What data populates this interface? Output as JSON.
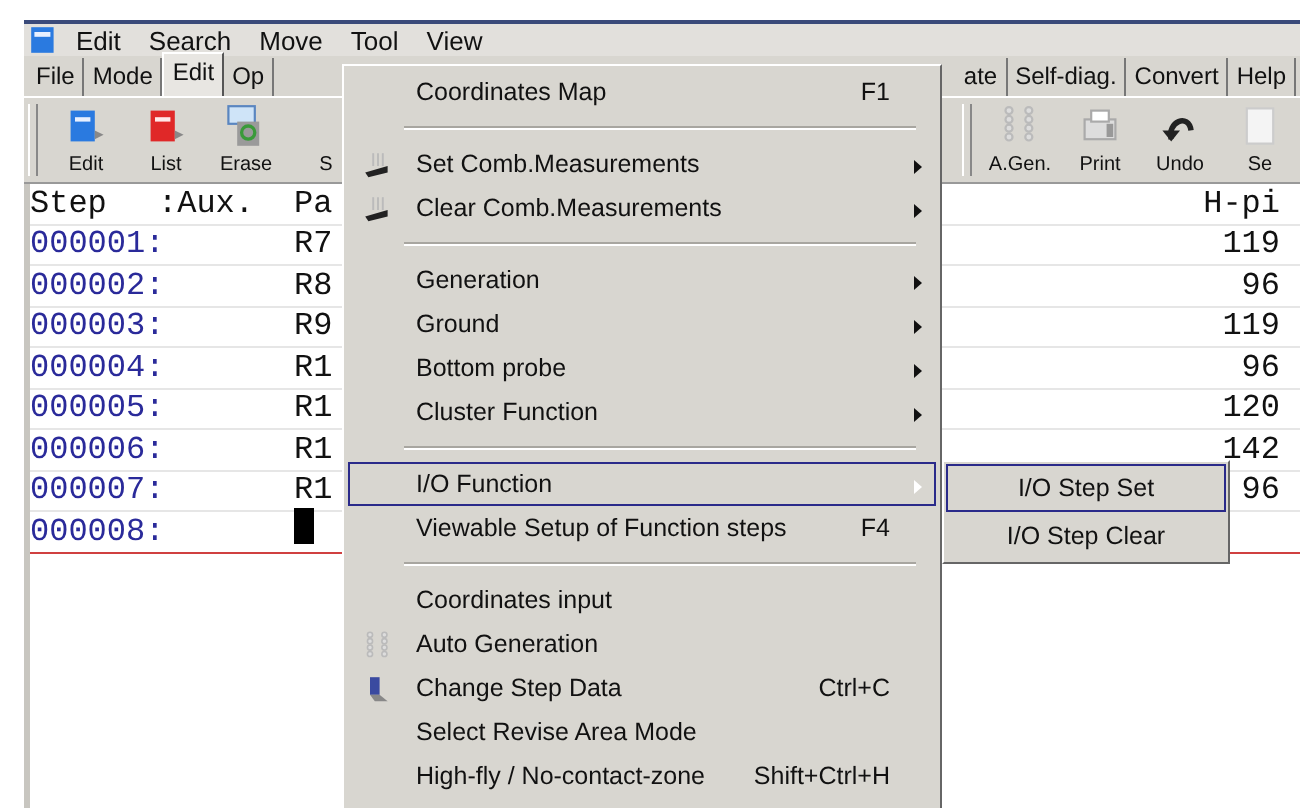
{
  "menubar": {
    "items": [
      {
        "label": "Edit"
      },
      {
        "label": "Search"
      },
      {
        "label": "Move"
      },
      {
        "label": "Tool"
      },
      {
        "label": "View"
      }
    ]
  },
  "tab_bar": {
    "left": [
      {
        "label": "File",
        "selected": false
      },
      {
        "label": "Mode",
        "selected": false
      },
      {
        "label": "Edit",
        "selected": true
      },
      {
        "label": "Op",
        "selected": false
      }
    ],
    "right": [
      {
        "label": "ate",
        "selected": false
      },
      {
        "label": "Self-diag.",
        "selected": false
      },
      {
        "label": "Convert",
        "selected": false
      },
      {
        "label": "Help",
        "selected": false
      }
    ]
  },
  "toolbar": {
    "left": [
      {
        "label": "Edit",
        "kind": "blue-book"
      },
      {
        "label": "List",
        "kind": "red-book"
      },
      {
        "label": "Erase",
        "kind": "erase"
      },
      {
        "label": "S",
        "kind": "none"
      }
    ],
    "right": [
      {
        "label": "A.Gen.",
        "kind": "pins"
      },
      {
        "label": "Print",
        "kind": "printer"
      },
      {
        "label": "Undo",
        "kind": "undo"
      },
      {
        "label": "Se",
        "kind": "page"
      }
    ]
  },
  "grid": {
    "columns": {
      "step": "Step",
      "aux": ":Aux.",
      "parameter": "Pa",
      "h_pin": "H-pi"
    },
    "rows": [
      {
        "step": "000001:",
        "parameter": "R7",
        "h_pin": "119",
        "cursor": false
      },
      {
        "step": "000002:",
        "parameter": "R8",
        "h_pin": "96",
        "cursor": false
      },
      {
        "step": "000003:",
        "parameter": "R9",
        "h_pin": "119",
        "cursor": false
      },
      {
        "step": "000004:",
        "parameter": "R1",
        "h_pin": "96",
        "cursor": false
      },
      {
        "step": "000005:",
        "parameter": "R1",
        "h_pin": "120",
        "cursor": false
      },
      {
        "step": "000006:",
        "parameter": "R1",
        "h_pin": "142",
        "cursor": false
      },
      {
        "step": "000007:",
        "parameter": "R1",
        "h_pin": "96",
        "cursor": false
      },
      {
        "step": "000008:",
        "cursor": true
      }
    ]
  },
  "tool_menu": {
    "items": [
      {
        "kind": "item",
        "label": "Coordinates Map",
        "shortcut": "F1",
        "submenu": false,
        "selected": false
      },
      {
        "kind": "separator"
      },
      {
        "kind": "comb-item",
        "label": "Set Comb.Measurements",
        "submenu": true,
        "selected": false
      },
      {
        "kind": "comb-item",
        "label": "Clear Comb.Measurements",
        "submenu": true,
        "selected": false
      },
      {
        "kind": "separator"
      },
      {
        "kind": "item",
        "label": "Generation",
        "submenu": true,
        "selected": false
      },
      {
        "kind": "item",
        "label": "Ground",
        "submenu": true,
        "selected": false
      },
      {
        "kind": "item",
        "label": "Bottom probe",
        "submenu": true,
        "selected": false
      },
      {
        "kind": "item",
        "label": "Cluster Function",
        "submenu": true,
        "selected": false
      },
      {
        "kind": "separator"
      },
      {
        "kind": "item",
        "label": "I/O Function",
        "submenu": true,
        "selected": true,
        "submenu_items": [
          {
            "label": "I/O Step Set",
            "selected": true
          },
          {
            "label": "I/O Step Clear",
            "selected": false
          }
        ]
      },
      {
        "kind": "item",
        "label": "Viewable Setup of Function steps",
        "shortcut": "F4",
        "submenu": false,
        "selected": false
      },
      {
        "kind": "separator"
      },
      {
        "kind": "item",
        "label": "Coordinates input",
        "submenu": false,
        "selected": false
      },
      {
        "kind": "pins-item",
        "label": "Auto Generation",
        "submenu": false,
        "selected": false
      },
      {
        "kind": "pen-item",
        "label": "Change Step Data",
        "shortcut": "Ctrl+C",
        "submenu": false,
        "selected": false
      },
      {
        "kind": "item",
        "label": "Select Revise Area Mode",
        "submenu": false,
        "selected": false
      },
      {
        "kind": "item",
        "label": "High-fly / No-contact-zone",
        "shortcut": "Shift+Ctrl+H",
        "submenu": false,
        "selected": false
      }
    ]
  }
}
